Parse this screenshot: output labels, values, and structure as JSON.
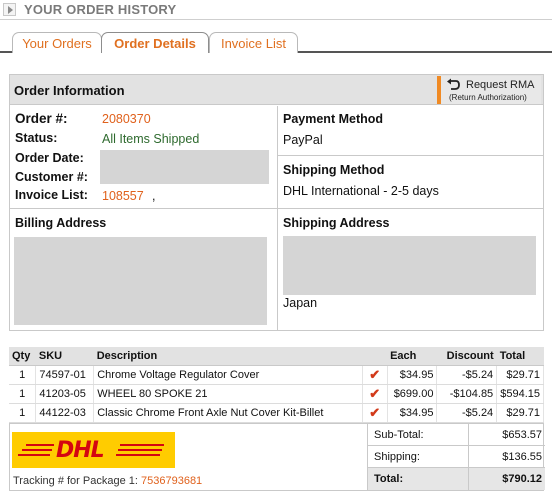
{
  "header": {
    "title": "YOUR ORDER HISTORY"
  },
  "tabs": [
    {
      "label": "Your Orders",
      "active": false
    },
    {
      "label": "Order Details",
      "active": true
    },
    {
      "label": "Invoice List",
      "active": false
    }
  ],
  "order_info": {
    "title": "Order Information",
    "rma": {
      "label": "Request RMA",
      "sub": "(Return Authorization)"
    },
    "order_no_label": "Order #:",
    "order_no": "2080370",
    "status_label": "Status:",
    "status": "All Items Shipped",
    "order_date_label": "Order Date:",
    "customer_label": "Customer #:",
    "invoice_label": "Invoice List:",
    "invoice_no": "108557",
    "invoice_sep": ",",
    "payment_label": "Payment Method",
    "payment": "PayPal",
    "shipping_method_label": "Shipping Method",
    "shipping_method": "DHL International - 2-5 days",
    "billing_label": "Billing Address",
    "shipping_addr_label": "Shipping Address",
    "shipping_country": "Japan"
  },
  "items": {
    "headers": [
      "Qty",
      "SKU",
      "Description",
      "",
      "Each",
      "Discount",
      "Total"
    ],
    "rows": [
      {
        "qty": "1",
        "sku": "74597-01",
        "desc": "Chrome Voltage Regulator Cover",
        "check": "✔",
        "each": "$34.95",
        "discount": "-$5.24",
        "total": "$29.71"
      },
      {
        "qty": "1",
        "sku": "41203-05",
        "desc": "WHEEL 80 SPOKE 21",
        "check": "✔",
        "each": "$699.00",
        "discount": "-$104.85",
        "total": "$594.15"
      },
      {
        "qty": "1",
        "sku": "44122-03",
        "desc": "Classic Chrome Front Axle Nut Cover Kit-Billet",
        "check": "✔",
        "each": "$34.95",
        "discount": "-$5.24",
        "total": "$29.71"
      }
    ]
  },
  "footer": {
    "carrier_logo": "DHL",
    "tracking_label": "Tracking # for Package 1:",
    "tracking_no": "7536793681",
    "subtotal_label": "Sub-Total:",
    "subtotal": "$653.57",
    "shipping_label": "Shipping:",
    "shipping": "$136.55",
    "total_label": "Total:",
    "total": "$790.12"
  },
  "colors": {
    "accent": "#e0611c",
    "status_green": "#2e6a2e",
    "header_gray": "#e2e2e2",
    "dhl_yellow": "#ffcc00",
    "dhl_red": "#d40511"
  }
}
